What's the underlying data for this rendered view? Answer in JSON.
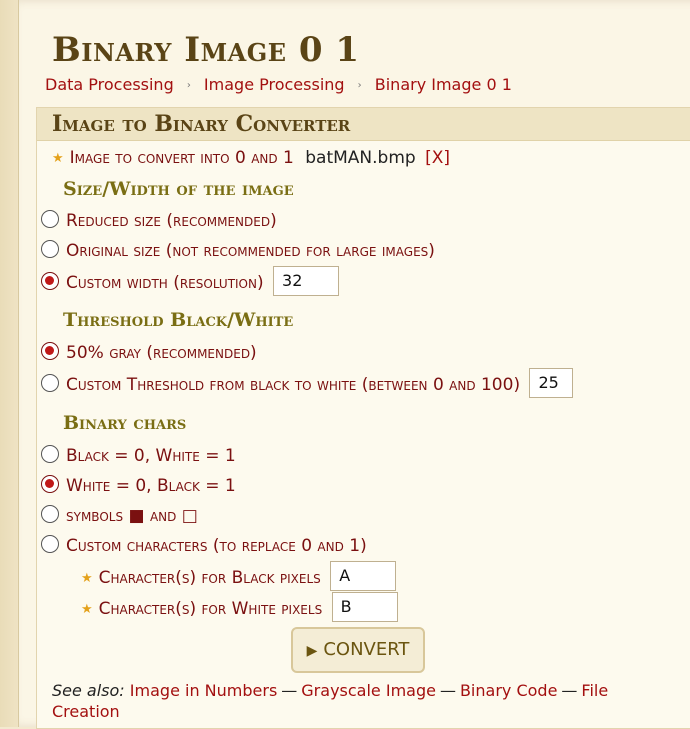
{
  "page": {
    "title": "Binary Image 0 1",
    "breadcrumb": [
      "Data Processing",
      "Image Processing",
      "Binary Image 0 1"
    ],
    "breadcrumb_separator": "›"
  },
  "tool": {
    "header": "Image to Binary Converter",
    "file": {
      "label": "Image to convert into 0 and 1",
      "filename": "batMAN.bmp",
      "remove": "[X]"
    },
    "size_section": {
      "title": "Size/Width of the image",
      "options": [
        {
          "label": "Reduced size (recommended)",
          "checked": false
        },
        {
          "label": "Original size (not recommended for large images)",
          "checked": false
        },
        {
          "label": "Custom width (resolution)",
          "checked": true
        }
      ],
      "custom_width": "32"
    },
    "threshold_section": {
      "title": "Threshold Black/White",
      "options": [
        {
          "label": "50% gray (recommended)",
          "checked": true
        },
        {
          "label": "Custom Threshold from black to white (between 0 and 100)",
          "checked": false
        }
      ],
      "custom_threshold": "25"
    },
    "chars_section": {
      "title": "Binary chars",
      "options": [
        {
          "label": "Black = 0, White = 1",
          "checked": false
        },
        {
          "label": "White = 0, Black = 1",
          "checked": true
        },
        {
          "label": "symbols ■ and □",
          "checked": false
        },
        {
          "label": "Custom characters (to replace 0 and 1)",
          "checked": false
        }
      ],
      "black_label": "Character(s) for Black pixels",
      "black_value": "A",
      "white_label": "Character(s) for White pixels",
      "white_value": "B"
    },
    "convert_label": "CONVERT",
    "see_also": {
      "label": "See also:",
      "links": [
        "Image in Numbers",
        "Grayscale Image",
        "Binary Code",
        "File Creation"
      ],
      "separator": "—"
    }
  },
  "colors": {
    "accent": "#a31010",
    "header_text": "#5a4416",
    "section_text": "#7a6e14",
    "star": "#e4a11b"
  }
}
